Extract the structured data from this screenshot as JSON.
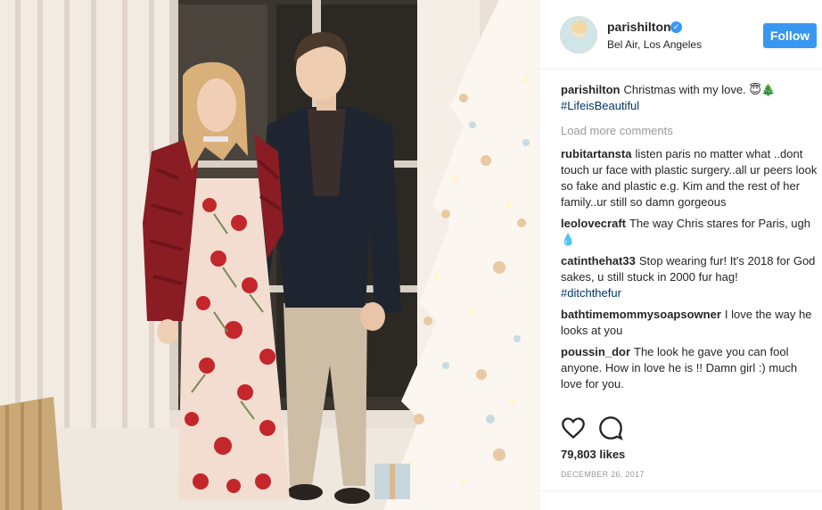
{
  "post": {
    "photo_alt": "",
    "author": {
      "username": "parishilton",
      "location": "Bel Air, Los Angeles",
      "verified_glyph": "✓"
    },
    "follow_label": "Follow",
    "caption": {
      "user": "parishilton",
      "text": "Christmas with my love. 😇🎄",
      "hashtag": "#LifeisBeautiful"
    },
    "load_more_label": "Load more comments",
    "comments": [
      {
        "user": "rubitartansta",
        "text": "listen paris no matter what ..dont touch ur face with plastic surgery..all ur peers look so fake and plastic e.g. Kim and the rest of her family..ur still so damn gorgeous",
        "tag": ""
      },
      {
        "user": "leolovecraft",
        "text": "The way Chris stares for Paris, ugh 💧",
        "tag": ""
      },
      {
        "user": "catinthehat33",
        "text": "Stop wearing fur! It's 2018 for God sakes, u still stuck in 2000 fur hag!",
        "tag": "#ditchthefur"
      },
      {
        "user": "bathtimemommysoapsowner",
        "text": "I love the way he looks at you",
        "tag": ""
      },
      {
        "user": "poussin_dor",
        "text": "The look he gave you can fool anyone. How in love he is !! Damn girl :) much love for you.",
        "tag": ""
      }
    ],
    "likes_label": "79,803 likes",
    "date_label": "DECEMBER 26, 2017"
  },
  "icons": {
    "like": "heart-icon",
    "comment": "speech-bubble-icon",
    "verified": "verified-badge-icon"
  },
  "colors": {
    "accent": "#3897f0",
    "hashtag": "#003569",
    "muted": "#999999",
    "text": "#262626"
  }
}
